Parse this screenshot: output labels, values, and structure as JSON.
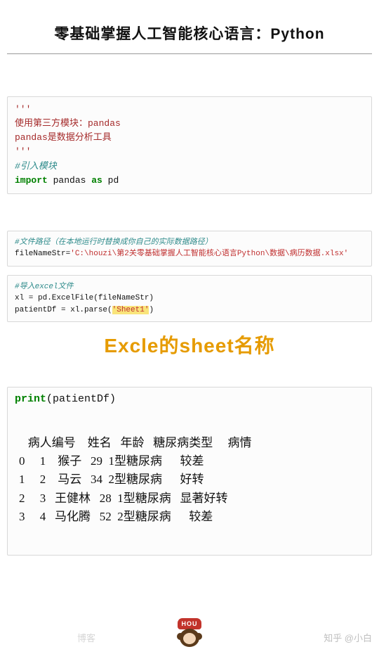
{
  "title": "零基础掌握人工智能核心语言：Python",
  "code1": {
    "l1": "'''",
    "l2": "使用第三方模块：pandas",
    "l3": "pandas是数据分析工具",
    "l4": "'''",
    "l5": "#引入模块",
    "l6a": "import",
    "l6b": " pandas ",
    "l6c": "as",
    "l6d": " pd"
  },
  "code2": {
    "l1": "#文件路径（在本地运行时替换成你自己的实际数据路径）",
    "l2a": "fileNameStr=",
    "l2b": "'C:\\houzi\\第2关零基础掌握人工智能核心语言Python\\数据\\病历数据.xlsx'"
  },
  "code3": {
    "l1": "#导入excel文件",
    "l2": "xl = pd.ExcelFile(fileNameStr)",
    "l3a": "patientDf = xl.parse(",
    "l3b": "'Sheet1'",
    "l3c": ")"
  },
  "annotation": "Excle的sheet名称",
  "code4": {
    "la": "print",
    "lb": "(patientDf)"
  },
  "table": {
    "header": "   病人编号    姓名   年龄   糖尿病类型     病情",
    "r0": "0     1    猴子   29  1型糖尿病      较差",
    "r1": "1     2    马云   34  2型糖尿病      好转",
    "r2": "2     3   王健林   28  1型糖尿病   显著好转",
    "r3": "3     4   马化腾   52  2型糖尿病      较差"
  },
  "chart_data": {
    "type": "table",
    "columns": [
      "病人编号",
      "姓名",
      "年龄",
      "糖尿病类型",
      "病情"
    ],
    "index": [
      0,
      1,
      2,
      3
    ],
    "rows": [
      [
        1,
        "猴子",
        29,
        "1型糖尿病",
        "较差"
      ],
      [
        2,
        "马云",
        34,
        "2型糖尿病",
        "好转"
      ],
      [
        3,
        "王健林",
        28,
        "1型糖尿病",
        "显著好转"
      ],
      [
        4,
        "马化腾",
        52,
        "2型糖尿病",
        "较差"
      ]
    ]
  },
  "logo": {
    "label": "HOU"
  },
  "watermark_right": "知乎 @小白",
  "watermark_left": "博客"
}
